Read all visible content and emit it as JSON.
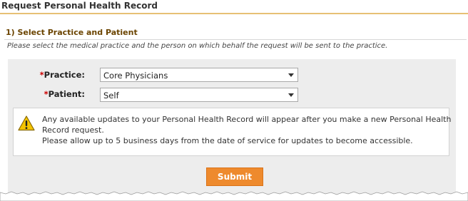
{
  "header": {
    "title": "Request Personal Health Record"
  },
  "section": {
    "title": "1) Select Practice and Patient",
    "description": "Please select the medical practice and the person on which behalf the request will be sent to the practice."
  },
  "form": {
    "required_marker": "*",
    "practice": {
      "label": "Practice:",
      "selected_value": "Core Physicians"
    },
    "patient": {
      "label": "Patient:",
      "selected_value": "Self"
    }
  },
  "notice": {
    "icon": "warning-icon",
    "line1": "Any available updates to your Personal Health Record will appear after you make a new Personal Health",
    "line2": "Record request.",
    "line3": "Please allow up to 5 business days from the date of service for updates to become accessible."
  },
  "actions": {
    "submit_label": "Submit"
  },
  "colors": {
    "accent": "#ee8a2d",
    "header_rule": "#e7c074",
    "section_title": "#6b4400",
    "required": "#cc0000",
    "panel_bg": "#ededed",
    "warning": "#f5c400"
  }
}
